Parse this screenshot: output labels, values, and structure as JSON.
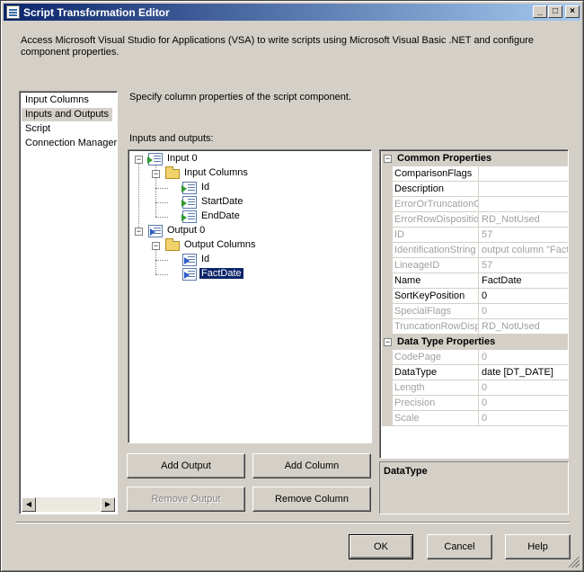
{
  "window": {
    "title": "Script Transformation Editor",
    "minimize_glyph": "_",
    "maximize_glyph": "□",
    "close_glyph": "×"
  },
  "description": "Access Microsoft Visual Studio for Applications (VSA) to write scripts using Microsoft Visual Basic .NET and configure component properties.",
  "nav": {
    "items": [
      {
        "label": "Input Columns"
      },
      {
        "label": "Inputs and Outputs"
      },
      {
        "label": "Script"
      },
      {
        "label": "Connection Managers"
      }
    ],
    "selected": "Inputs and Outputs"
  },
  "main": {
    "subtitle": "Specify column properties of the script component.",
    "tree_label": "Inputs and outputs:",
    "tree": {
      "input0": "Input 0",
      "input_columns": "Input Columns",
      "input_cols": [
        "Id",
        "StartDate",
        "EndDate"
      ],
      "output0": "Output 0",
      "output_columns": "Output Columns",
      "output_cols": [
        "Id",
        "FactDate"
      ],
      "selected": "FactDate"
    }
  },
  "buttons": {
    "add_output": "Add Output",
    "add_column": "Add Column",
    "remove_output": "Remove Output",
    "remove_column": "Remove Column",
    "ok": "OK",
    "cancel": "Cancel",
    "help": "Help"
  },
  "properties": {
    "common_title": "Common Properties",
    "common": [
      {
        "name": "ComparisonFlags",
        "value": "",
        "dim": false
      },
      {
        "name": "Description",
        "value": "",
        "dim": false
      },
      {
        "name": "ErrorOrTruncationO",
        "value": "",
        "dim": true
      },
      {
        "name": "ErrorRowDispositio",
        "value": "RD_NotUsed",
        "dim": true
      },
      {
        "name": "ID",
        "value": "57",
        "dim": true
      },
      {
        "name": "IdentificationString",
        "value": "output column \"FactD",
        "dim": true
      },
      {
        "name": "LineageID",
        "value": "57",
        "dim": true
      },
      {
        "name": "Name",
        "value": "FactDate",
        "dim": false
      },
      {
        "name": "SortKeyPosition",
        "value": "0",
        "dim": false
      },
      {
        "name": "SpecialFlags",
        "value": "0",
        "dim": true
      },
      {
        "name": "TruncationRowDisp",
        "value": "RD_NotUsed",
        "dim": true
      }
    ],
    "datatype_title": "Data Type Properties",
    "datatype": [
      {
        "name": "CodePage",
        "value": "0",
        "dim": true
      },
      {
        "name": "DataType",
        "value": "date [DT_DATE]",
        "dim": false
      },
      {
        "name": "Length",
        "value": "0",
        "dim": true
      },
      {
        "name": "Precision",
        "value": "0",
        "dim": true
      },
      {
        "name": "Scale",
        "value": "0",
        "dim": true
      }
    ],
    "help_title": "DataType"
  },
  "colors": {
    "titlebar_start": "#0a246a",
    "titlebar_end": "#a6caf0",
    "selection": "#0a246a",
    "dialog_face": "#d4d0c8"
  }
}
